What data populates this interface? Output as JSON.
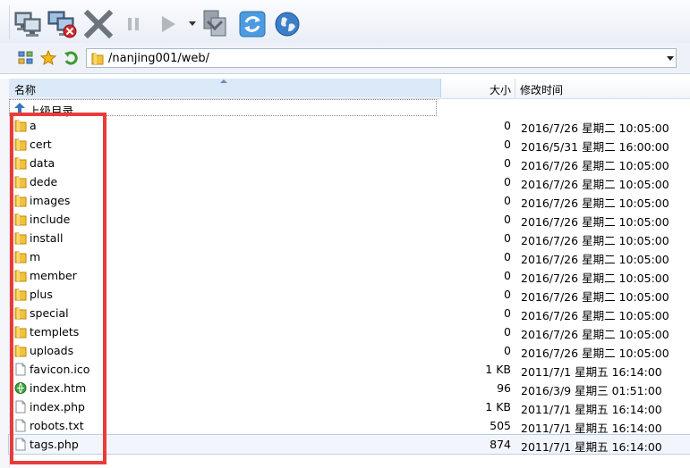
{
  "toolbar": {
    "buttons": [
      {
        "id": "connect",
        "icon": "computer-icon"
      },
      {
        "id": "disconnect",
        "icon": "computer-disconnect-icon"
      },
      {
        "id": "cancel",
        "icon": "close-icon"
      },
      {
        "id": "pause",
        "icon": "pause-icon"
      },
      {
        "id": "play",
        "icon": "play-icon"
      },
      {
        "id": "queue",
        "icon": "transfer-queue-icon"
      },
      {
        "id": "refresh",
        "icon": "refresh-icon"
      },
      {
        "id": "browser",
        "icon": "globe-icon"
      }
    ]
  },
  "address": {
    "path": "/nanjing001/web/",
    "icons": [
      "tree-view-icon",
      "favorites-star-icon",
      "up-folder-icon"
    ]
  },
  "columns": {
    "name": "名称",
    "size": "大小",
    "modified": "修改时间"
  },
  "parent_dir_label": "上级目录",
  "files": [
    {
      "name": "a",
      "type": "folder",
      "size": "0",
      "modified": "2016/7/26 星期二 10:05:00"
    },
    {
      "name": "cert",
      "type": "folder",
      "size": "0",
      "modified": "2016/5/31 星期二 16:00:00"
    },
    {
      "name": "data",
      "type": "folder",
      "size": "0",
      "modified": "2016/7/26 星期二 10:05:00"
    },
    {
      "name": "dede",
      "type": "folder",
      "size": "0",
      "modified": "2016/7/26 星期二 10:05:00"
    },
    {
      "name": "images",
      "type": "folder",
      "size": "0",
      "modified": "2016/7/26 星期二 10:05:00"
    },
    {
      "name": "include",
      "type": "folder",
      "size": "0",
      "modified": "2016/7/26 星期二 10:05:00"
    },
    {
      "name": "install",
      "type": "folder",
      "size": "0",
      "modified": "2016/7/26 星期二 10:05:00"
    },
    {
      "name": "m",
      "type": "folder",
      "size": "0",
      "modified": "2016/7/26 星期二 10:05:00"
    },
    {
      "name": "member",
      "type": "folder",
      "size": "0",
      "modified": "2016/7/26 星期二 10:05:00"
    },
    {
      "name": "plus",
      "type": "folder",
      "size": "0",
      "modified": "2016/7/26 星期二 10:05:00"
    },
    {
      "name": "special",
      "type": "folder",
      "size": "0",
      "modified": "2016/7/26 星期二 10:05:00"
    },
    {
      "name": "templets",
      "type": "folder",
      "size": "0",
      "modified": "2016/7/26 星期二 10:05:00"
    },
    {
      "name": "uploads",
      "type": "folder",
      "size": "0",
      "modified": "2016/7/26 星期二 10:05:00"
    },
    {
      "name": "favicon.ico",
      "type": "file",
      "size": "1 KB",
      "modified": "2011/7/1 星期五 16:14:00"
    },
    {
      "name": "index.htm",
      "type": "html",
      "size": "96",
      "modified": "2016/3/9 星期三 01:51:00"
    },
    {
      "name": "index.php",
      "type": "file",
      "size": "1 KB",
      "modified": "2011/7/1 星期五 16:14:00"
    },
    {
      "name": "robots.txt",
      "type": "file",
      "size": "505",
      "modified": "2011/7/1 星期五 16:14:00"
    },
    {
      "name": "tags.php",
      "type": "file",
      "size": "874",
      "modified": "2011/7/1 星期五 16:14:00",
      "selected": true
    }
  ],
  "colors": {
    "highlight_box": "#ea3b3b",
    "folder": "#f2c23b",
    "header_sorted": "#dbe9f8"
  }
}
